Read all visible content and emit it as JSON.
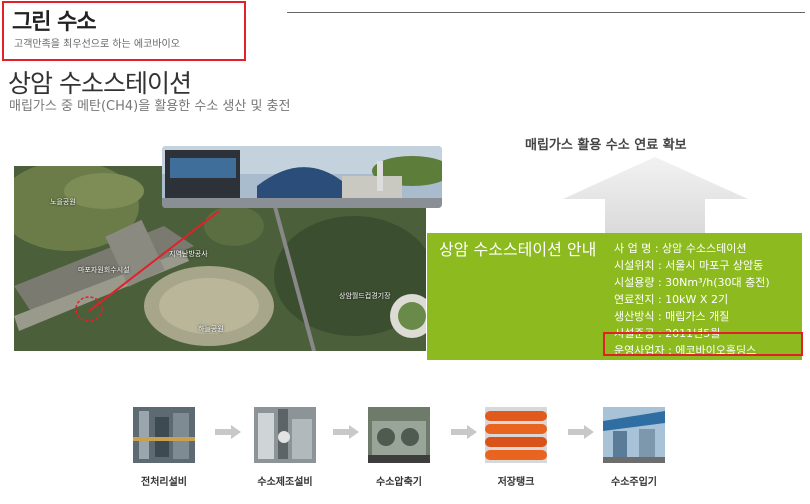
{
  "brand": {
    "title": "그린 수소",
    "slogan": "고객만족을 최우선으로 하는 에코바이오"
  },
  "page": {
    "title": "상암 수소스테이션",
    "subtitle": "매립가스 중 메탄(CH4)을 활용한 수소 생산 및 충전"
  },
  "hero": {
    "arrow_text": "매립가스 활용 수소 연료 확보"
  },
  "map": {
    "labels": [
      "노을공원",
      "마포자원회수시설",
      "지역난방공사",
      "상암월드컵경기장",
      "하늘공원"
    ]
  },
  "info": {
    "title": "상암 수소스테이션 안내",
    "items": [
      "사 업 명 : 상암 수소스테이션",
      "시설위치 : 서울시 마포구 상암동",
      "시설용량 : 30Nm³/h(30대 충전)",
      "연료전지 : 10kW X 2기",
      "생산방식 : 매립가스 개질",
      "시설준공 : 2011년5월",
      "운영사업자 : 에코바이오홀딩스"
    ]
  },
  "process": {
    "steps": [
      {
        "label": "전처리설비",
        "icon": "pretreatment-equipment-image"
      },
      {
        "label": "수소제조설비",
        "icon": "hydrogen-production-image"
      },
      {
        "label": "수소압축기",
        "icon": "hydrogen-compressor-image"
      },
      {
        "label": "저장탱크",
        "icon": "storage-tank-image"
      },
      {
        "label": "수소주입기",
        "icon": "hydrogen-dispenser-image"
      }
    ]
  },
  "colors": {
    "accent_green": "#8cba1f",
    "highlight_red": "#e2202a"
  }
}
